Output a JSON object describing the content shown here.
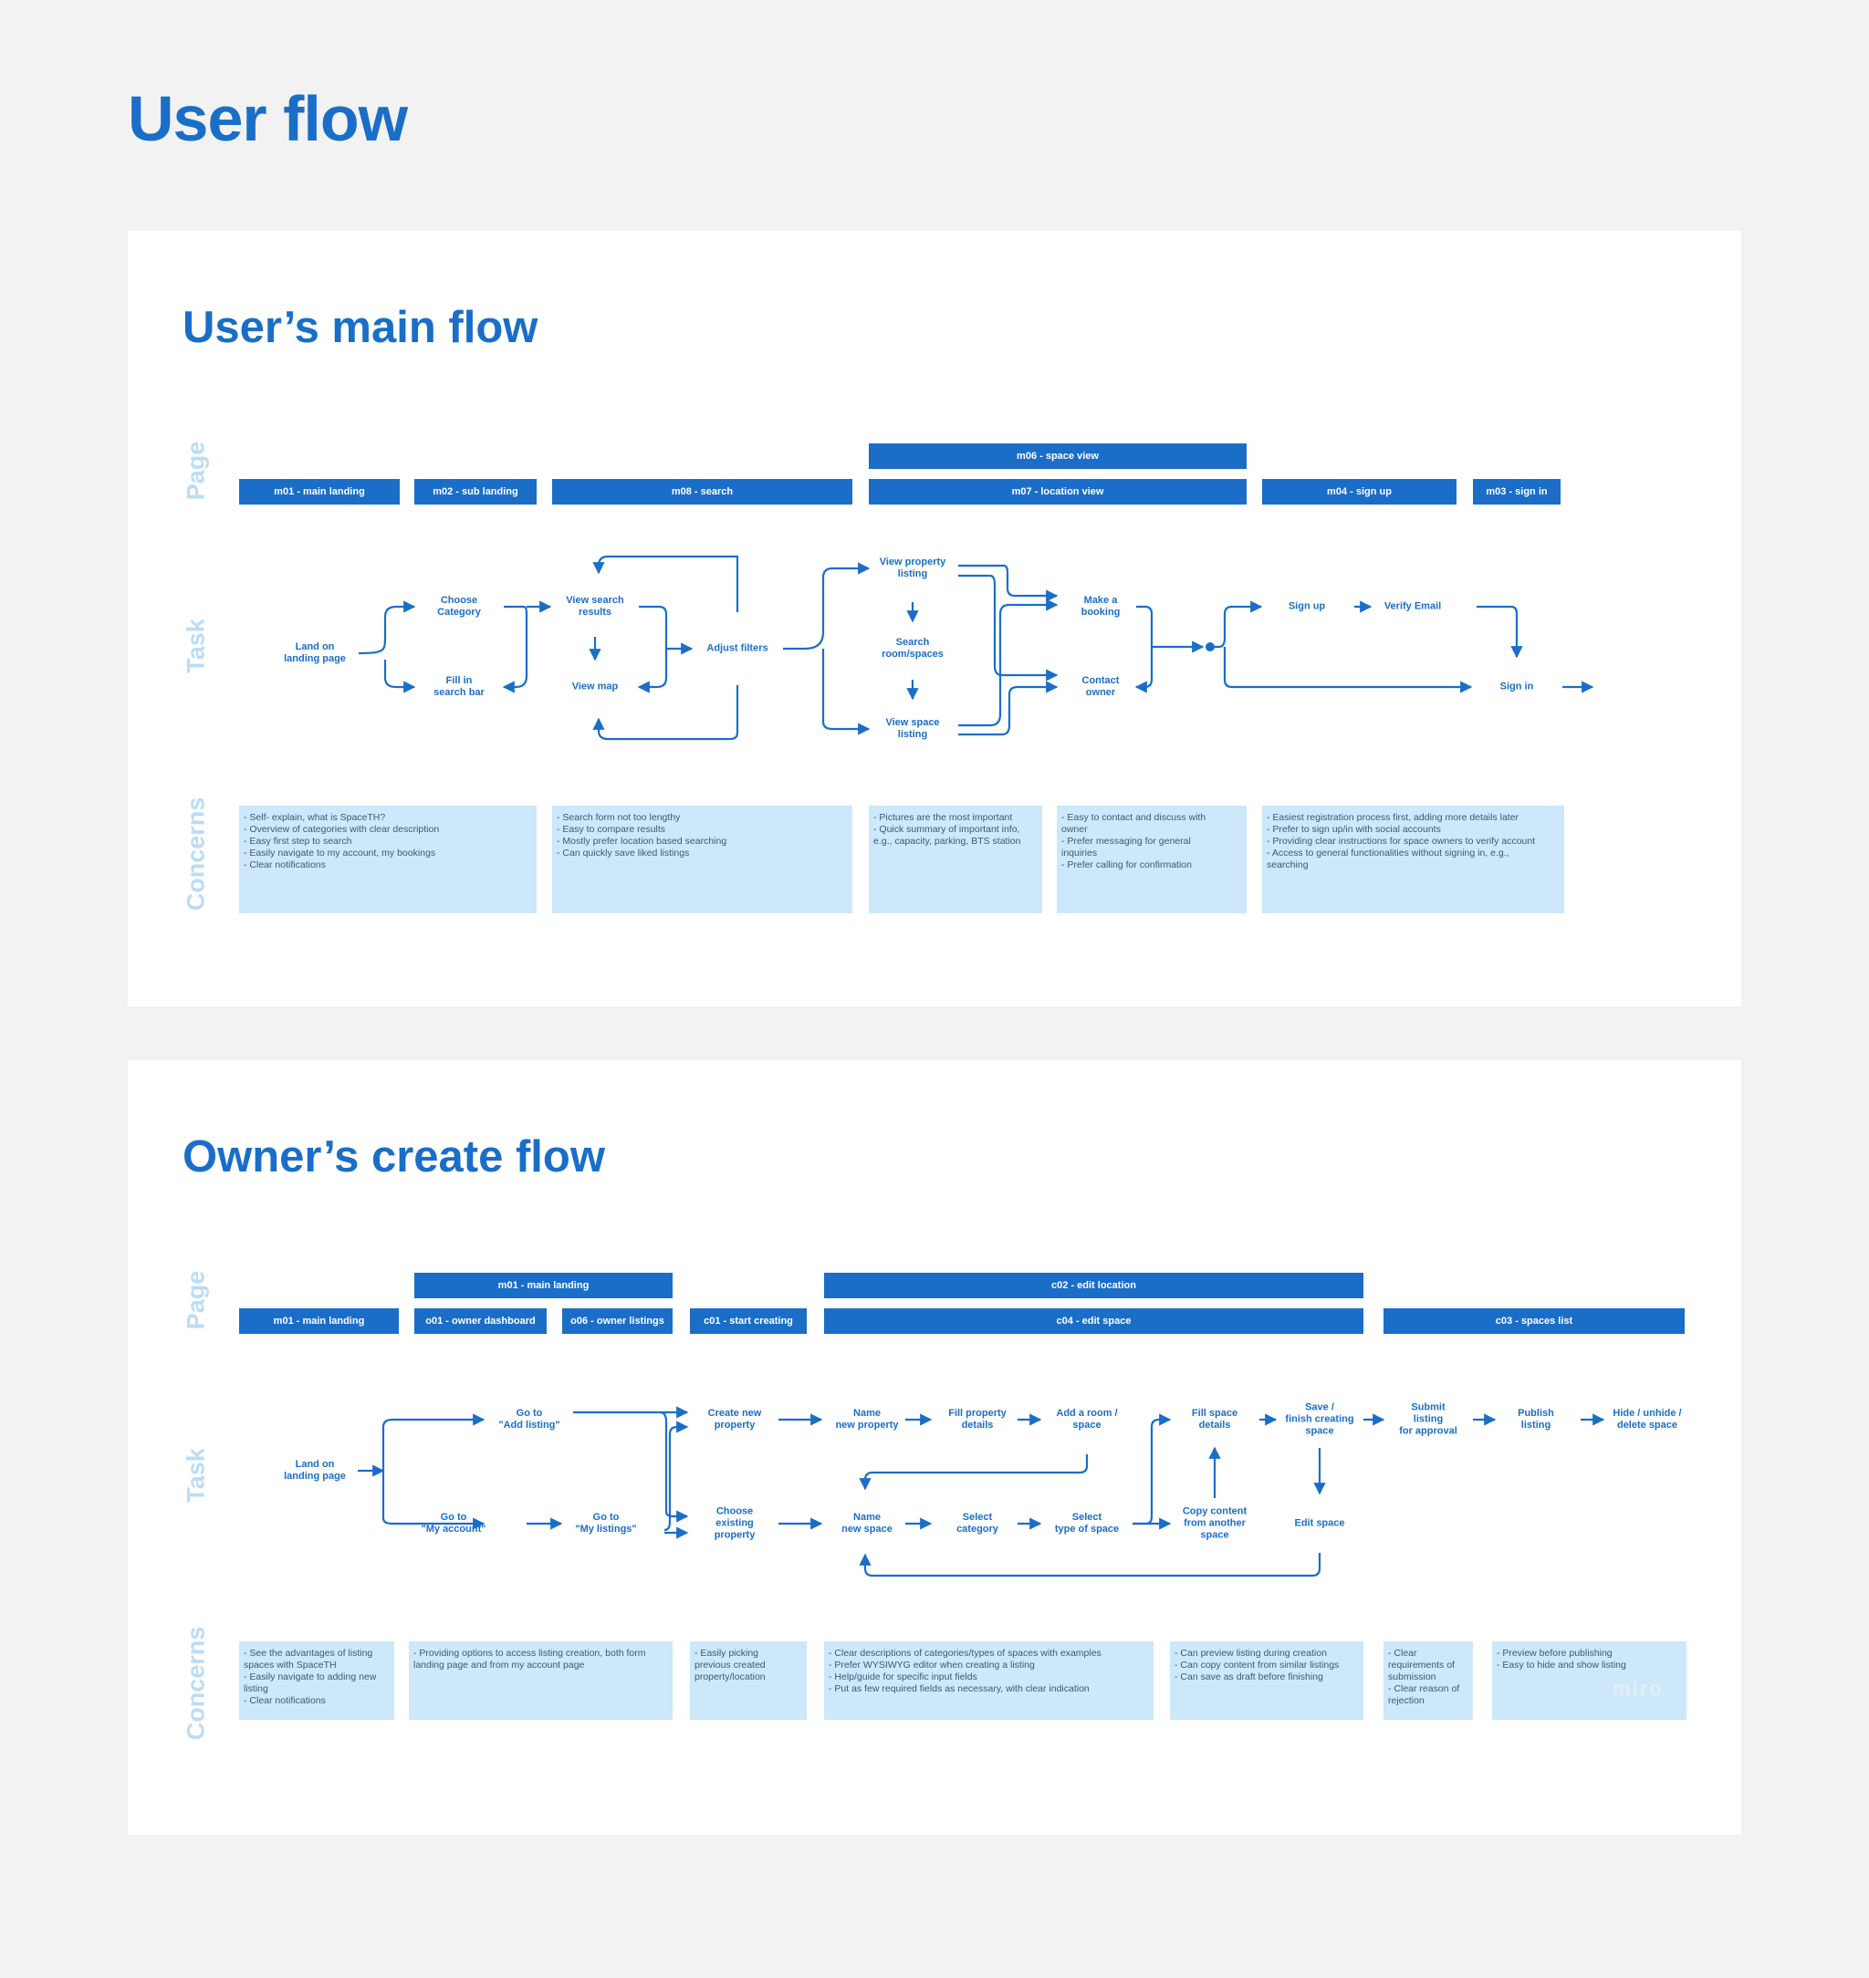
{
  "title": "User flow",
  "row_labels": {
    "page": "Page",
    "task": "Task",
    "concerns": "Concerns"
  },
  "main_flow": {
    "title": "User’s main flow",
    "pages": {
      "m06": "m06 - space view",
      "m01": "m01 - main landing",
      "m02": "m02 - sub landing",
      "m08": "m08 - search",
      "m07": "m07 - location view",
      "m04": "m04 - sign up",
      "m03": "m03 - sign in"
    },
    "tasks": {
      "land": "Land on\nlanding page",
      "choose_category": "Choose\nCategory",
      "fill_search": "Fill in\nsearch bar",
      "view_results": "View search\nresults",
      "view_map": "View map",
      "adjust_filters": "Adjust filters",
      "view_property": "View property\nlisting",
      "search_rooms": "Search\nroom/spaces",
      "view_space": "View space\nlisting",
      "make_booking": "Make a\nbooking",
      "contact_owner": "Contact\nowner",
      "sign_up": "Sign up",
      "verify_email": "Verify Email",
      "sign_in": "Sign in"
    },
    "concerns": {
      "c1": "- Self- explain, what is SpaceTH?\n- Overview of categories with clear description\n- Easy first step to search\n- Easily navigate to my account, my bookings\n- Clear notifications",
      "c2": "- Search form not too lengthy\n- Easy to compare results\n- Mostly prefer location based searching\n- Can quickly save liked listings",
      "c3": "- Pictures are the most important\n- Quick summary of important info,\ne.g., capacity, parking, BTS station",
      "c4": "- Easy to contact and discuss with\nowner\n- Prefer messaging for general\ninquiries\n- Prefer calling for confirmation",
      "c5": "- Easiest registration process first, adding more details later\n- Prefer to sign up/in with social accounts\n- Providing clear instructions for space owners to verify account\n- Access to general functionalities without signing in, e.g.,\nsearching"
    }
  },
  "create_flow": {
    "title": "Owner’s create flow",
    "pages": {
      "m01_top": "m01 - main landing",
      "c02": "c02 - edit location",
      "m01": "m01 - main landing",
      "o01": "o01 - owner dashboard",
      "o06": "o06 - owner listings",
      "c01": "c01 - start creating",
      "c04": "c04 - edit space",
      "c03": "c03 - spaces list"
    },
    "tasks": {
      "land": "Land on\nlanding page",
      "goto_add": "Go to\n\"Add listing\"",
      "goto_account": "Go to\n\"My account\"",
      "goto_listings": "Go to\n\"My listings\"",
      "create_property": "Create new\nproperty",
      "choose_property": "Choose\nexisting\nproperty",
      "name_property": "Name\nnew property",
      "fill_property": "Fill property\ndetails",
      "add_room": "Add a room /\nspace",
      "name_space": "Name\nnew space",
      "select_category": "Select\ncategory",
      "select_type": "Select\ntype of space",
      "fill_space": "Fill space\ndetails",
      "copy_content": "Copy content\nfrom another\nspace",
      "save_finish": "Save /\nfinish creating\nspace",
      "edit_space": "Edit space",
      "submit": "Submit\nlisting\nfor approval",
      "publish": "Publish\nlisting",
      "hide_delete": "Hide / unhide /\ndelete space"
    },
    "concerns": {
      "c1": "- See the advantages of listing\nspaces with SpaceTH\n- Easily navigate to adding new\nlisting\n- Clear notifications",
      "c2": "- Providing options to access listing creation, both form\nlanding page and from my account page",
      "c3": "- Easily picking\nprevious created\nproperty/location",
      "c4": "- Clear descriptions of categories/types of spaces with examples\n- Prefer WYSIWYG editor when creating a listing\n- Help/guide for specific input fields\n- Put as few required fields as necessary, with clear indication",
      "c5": "- Can preview listing during creation\n- Can copy content from similar listings\n- Can save as draft before finishing",
      "c6": "- Clear\nrequirements of\nsubmission\n- Clear reason of\nrejection",
      "c7": "- Preview before publishing\n- Easy to hide and show listing"
    },
    "watermark": "miro"
  },
  "colors": {
    "accent": "#1a6ec8",
    "concern_bg": "#cce8fa",
    "row_label": "#bcdcf6"
  }
}
